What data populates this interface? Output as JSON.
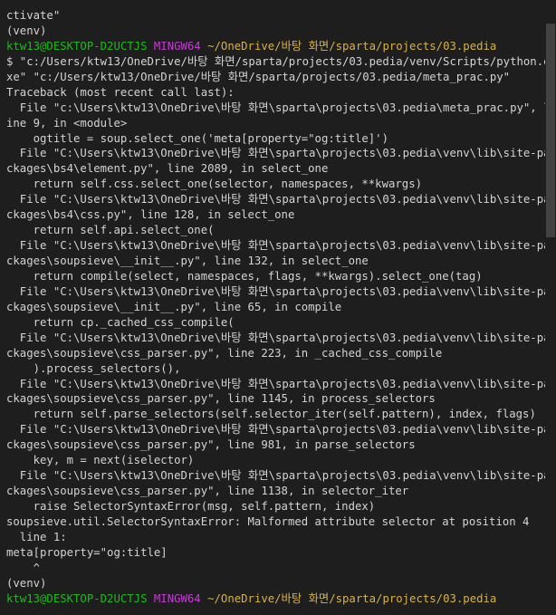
{
  "terminal": {
    "lines": [
      "ctivate\"",
      "(venv)",
      {
        "prompt": {
          "user": "ktw13@DESKTOP-D2UCTJS",
          "system": "MINGW64",
          "path": "~/OneDrive/바탕 화면/sparta/projects/03.pedia"
        }
      },
      "$ \"c:/Users/ktw13/OneDrive/바탕 화면/sparta/projects/03.pedia/venv/Scripts/python.e",
      "xe\" \"c:/Users/ktw13/OneDrive/바탕 화면/sparta/projects/03.pedia/meta_prac.py\"",
      "Traceback (most recent call last):",
      "  File \"c:\\Users\\ktw13\\OneDrive\\바탕 화면\\sparta\\projects\\03.pedia\\meta_prac.py\", l",
      "ine 9, in <module>",
      "    ogtitle = soup.select_one('meta[property=\"og:title]')",
      "  File \"C:\\Users\\ktw13\\OneDrive\\바탕 화면\\sparta\\projects\\03.pedia\\venv\\lib\\site-pa",
      "ckages\\bs4\\element.py\", line 2089, in select_one",
      "    return self.css.select_one(selector, namespaces, **kwargs)",
      "  File \"C:\\Users\\ktw13\\OneDrive\\바탕 화면\\sparta\\projects\\03.pedia\\venv\\lib\\site-pa",
      "ckages\\bs4\\css.py\", line 128, in select_one",
      "    return self.api.select_one(",
      "  File \"C:\\Users\\ktw13\\OneDrive\\바탕 화면\\sparta\\projects\\03.pedia\\venv\\lib\\site-pa",
      "ckages\\soupsieve\\__init__.py\", line 132, in select_one",
      "    return compile(select, namespaces, flags, **kwargs).select_one(tag)",
      "  File \"C:\\Users\\ktw13\\OneDrive\\바탕 화면\\sparta\\projects\\03.pedia\\venv\\lib\\site-pa",
      "ckages\\soupsieve\\__init__.py\", line 65, in compile",
      "    return cp._cached_css_compile(",
      "  File \"C:\\Users\\ktw13\\OneDrive\\바탕 화면\\sparta\\projects\\03.pedia\\venv\\lib\\site-pa",
      "ckages\\soupsieve\\css_parser.py\", line 223, in _cached_css_compile",
      "    ).process_selectors(),",
      "  File \"C:\\Users\\ktw13\\OneDrive\\바탕 화면\\sparta\\projects\\03.pedia\\venv\\lib\\site-pa",
      "ckages\\soupsieve\\css_parser.py\", line 1145, in process_selectors",
      "    return self.parse_selectors(self.selector_iter(self.pattern), index, flags)",
      "  File \"C:\\Users\\ktw13\\OneDrive\\바탕 화면\\sparta\\projects\\03.pedia\\venv\\lib\\site-pa",
      "ckages\\soupsieve\\css_parser.py\", line 981, in parse_selectors",
      "    key, m = next(iselector)",
      "  File \"C:\\Users\\ktw13\\OneDrive\\바탕 화면\\sparta\\projects\\03.pedia\\venv\\lib\\site-pa",
      "ckages\\soupsieve\\css_parser.py\", line 1138, in selector_iter",
      "    raise SelectorSyntaxError(msg, self.pattern, index)",
      "soupsieve.util.SelectorSyntaxError: Malformed attribute selector at position 4",
      "  line 1:",
      "meta[property=\"og:title]",
      "    ^",
      "(venv)",
      {
        "prompt": {
          "user": "ktw13@DESKTOP-D2UCTJS",
          "system": "MINGW64",
          "path": "~/OneDrive/바탕 화면/sparta/projects/03.pedia"
        }
      }
    ]
  },
  "colors": {
    "background": "#1e1e1e",
    "text": "#d4d4d4",
    "prompt_user": "#1fb91f",
    "prompt_system": "#c53cd4",
    "prompt_path": "#d6b24a"
  }
}
